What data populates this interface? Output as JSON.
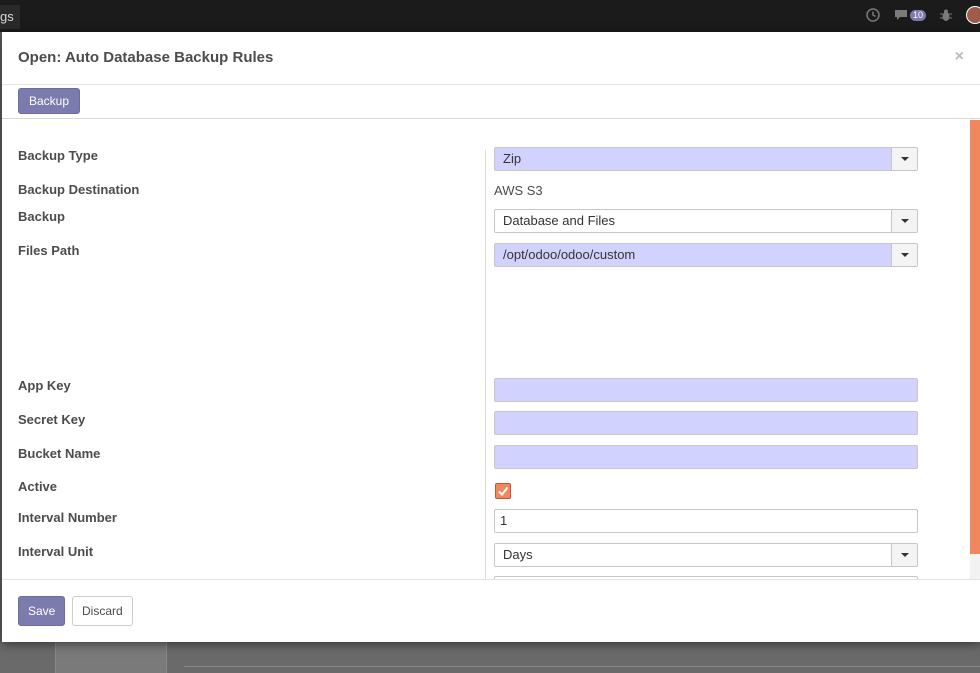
{
  "topbar": {
    "app_crumb": "gs",
    "messages_count": "10",
    "icons": [
      "clock-icon",
      "chat-icon",
      "bug-icon",
      "user-avatar"
    ]
  },
  "modal": {
    "title": "Open: Auto Database Backup Rules",
    "close_label": "×",
    "status_button": "Backup",
    "fields": {
      "backup_type": {
        "label": "Backup Type",
        "value": "Zip"
      },
      "backup_destination": {
        "label": "Backup Destination",
        "value": "AWS S3"
      },
      "backup": {
        "label": "Backup",
        "value": "Database and Files"
      },
      "files_path": {
        "label": "Files Path",
        "value": "/opt/odoo/odoo/custom"
      },
      "app_key": {
        "label": "App Key",
        "value": ""
      },
      "secret_key": {
        "label": "Secret Key",
        "value": ""
      },
      "bucket_name": {
        "label": "Bucket Name",
        "value": ""
      },
      "active": {
        "label": "Active",
        "checked": true
      },
      "interval_number": {
        "label": "Interval Number",
        "value": "1"
      },
      "interval_unit": {
        "label": "Interval Unit",
        "value": "Days"
      }
    },
    "footer": {
      "save_label": "Save",
      "discard_label": "Discard"
    }
  },
  "colors": {
    "primary": "#7c7bad",
    "required_field": "#d2d2ff",
    "accent": "#f0875d"
  }
}
